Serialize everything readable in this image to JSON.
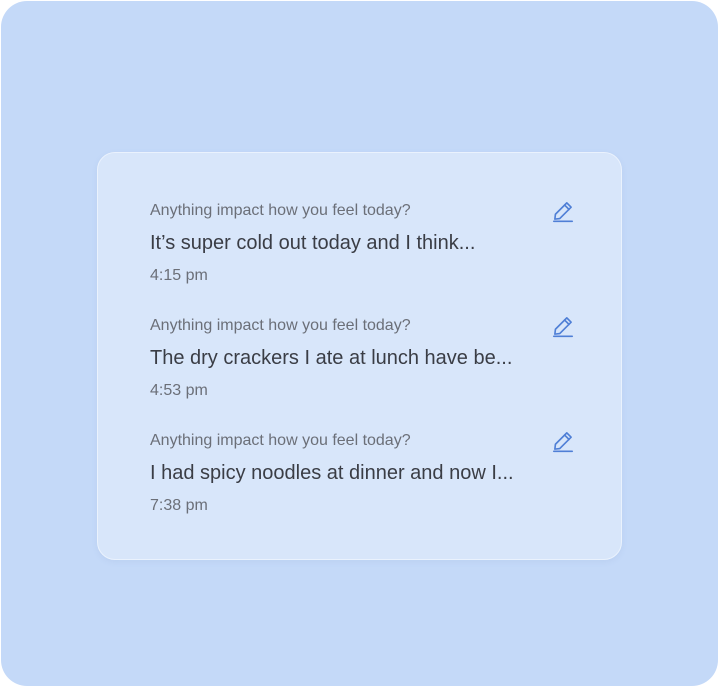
{
  "entries": [
    {
      "question": "Anything impact how you feel today?",
      "answer": "It’s super cold out today and I think...",
      "time": "4:15 pm",
      "icon": "edit-pencil-icon"
    },
    {
      "question": "Anything impact how you feel today?",
      "answer": "The dry crackers I ate at lunch have be...",
      "time": "4:53 pm",
      "icon": "edit-pencil-icon"
    },
    {
      "question": "Anything impact how you feel today?",
      "answer": "I had spicy noodles at dinner and now I...",
      "time": "7:38 pm",
      "icon": "edit-pencil-icon"
    }
  ],
  "colors": {
    "background": "#c4d9f8",
    "card": "#d8e6fa",
    "accent_icon": "#4f7fd6",
    "text_primary": "#3a3d45",
    "text_secondary": "#6b6f78"
  }
}
